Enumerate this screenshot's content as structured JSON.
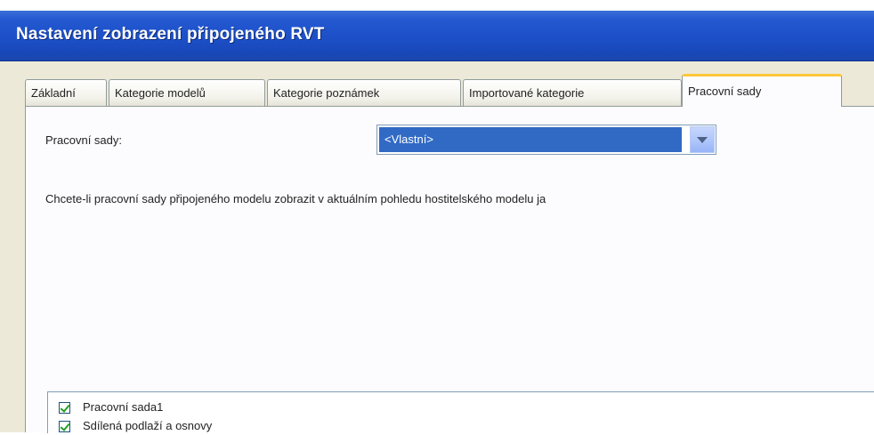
{
  "window": {
    "title": "Nastavení zobrazení připojeného RVT"
  },
  "tabs": [
    {
      "label": "Základní"
    },
    {
      "label": "Kategorie modelů"
    },
    {
      "label": "Kategorie poznámek"
    },
    {
      "label": "Importované kategorie"
    },
    {
      "label": "Pracovní sady"
    }
  ],
  "active_tab": "Pracovní sady",
  "workset": {
    "label": "Pracovní sady:",
    "selected": "<Vlastní>",
    "hint": "Chcete-li pracovní sady připojeného modelu zobrazit v aktuálním pohledu hostitelského modelu ja"
  },
  "list": {
    "items": [
      {
        "label": "Pracovní sada1",
        "checked": true
      },
      {
        "label": "Sdílená podlaží a osnovy",
        "checked": true
      }
    ]
  },
  "colors": {
    "titlebar": "#1d50c8",
    "selection": "#316ac5",
    "active_tab_accent": "#ffc83c"
  }
}
